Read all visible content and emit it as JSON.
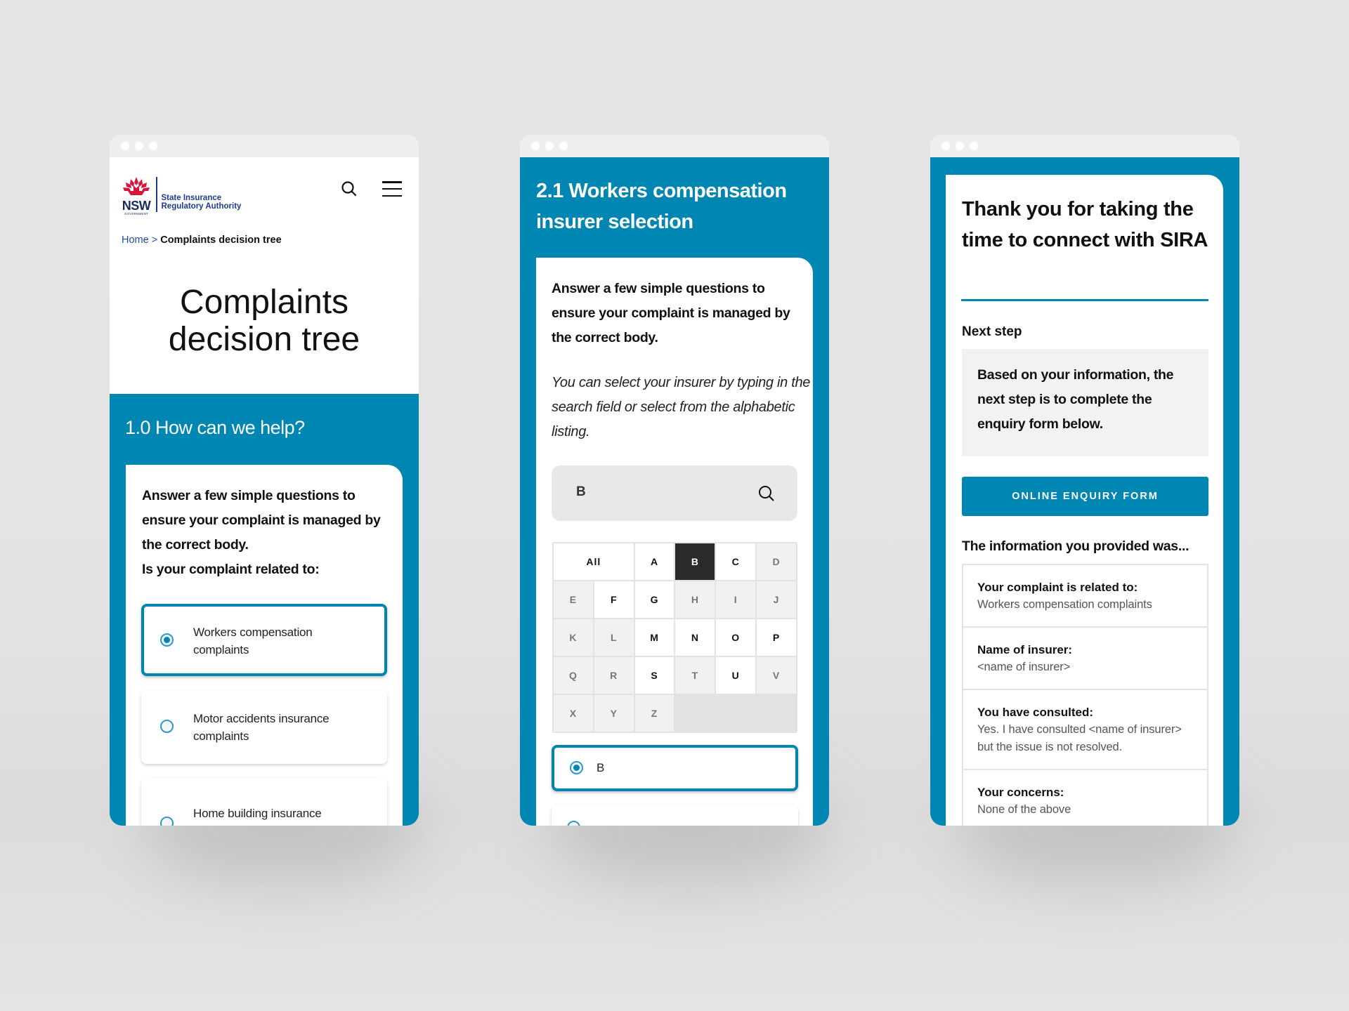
{
  "colors": {
    "accent": "#0086b3",
    "brand_red": "#d7153a",
    "brand_navy": "#1a2a5c"
  },
  "screen1": {
    "logo": {
      "mark": "NSW",
      "sub": "GOVERNMENT",
      "agency_line1": "State Insurance",
      "agency_line2": "Regulatory Authority"
    },
    "header_icons": [
      "search-icon",
      "menu-icon"
    ],
    "breadcrumb": {
      "home": "Home",
      "separator": " > ",
      "current": "Complaints decision tree"
    },
    "page_title_line1": "Complaints",
    "page_title_line2": "decision tree",
    "section_title": "1.0 How can we help?",
    "intro": "Answer a few simple questions to ensure your complaint is managed by the correct body.",
    "question": "Is your complaint related to:",
    "options": [
      {
        "label": "Workers compensation complaints",
        "selected": true
      },
      {
        "label": "Motor accidents insurance complaints",
        "selected": false
      },
      {
        "label": "Home building insurance",
        "selected": false
      }
    ]
  },
  "screen2": {
    "section_title": "2.1 Workers compensation insurer selection",
    "intro": "Answer a few simple questions to ensure your complaint is managed by the correct body.",
    "help_text": "You can select your insurer by typing in the search field or select from the alphabetic listing.",
    "search": {
      "value": "B",
      "icon": "search-icon"
    },
    "alphabet": [
      {
        "label": "All",
        "state": "enabled",
        "wide": true
      },
      {
        "label": "A",
        "state": "enabled"
      },
      {
        "label": "B",
        "state": "active"
      },
      {
        "label": "C",
        "state": "enabled"
      },
      {
        "label": "D",
        "state": "disabled"
      },
      {
        "label": "E",
        "state": "disabled"
      },
      {
        "label": "F",
        "state": "enabled"
      },
      {
        "label": "G",
        "state": "enabled"
      },
      {
        "label": "H",
        "state": "disabled"
      },
      {
        "label": "I",
        "state": "disabled"
      },
      {
        "label": "J",
        "state": "disabled"
      },
      {
        "label": "K",
        "state": "disabled"
      },
      {
        "label": "L",
        "state": "disabled"
      },
      {
        "label": "M",
        "state": "enabled"
      },
      {
        "label": "N",
        "state": "enabled"
      },
      {
        "label": "O",
        "state": "enabled"
      },
      {
        "label": "P",
        "state": "enabled"
      },
      {
        "label": "Q",
        "state": "disabled"
      },
      {
        "label": "R",
        "state": "disabled"
      },
      {
        "label": "S",
        "state": "enabled"
      },
      {
        "label": "T",
        "state": "disabled"
      },
      {
        "label": "U",
        "state": "enabled"
      },
      {
        "label": "V",
        "state": "disabled"
      },
      {
        "label": "X",
        "state": "disabled"
      },
      {
        "label": "Y",
        "state": "disabled"
      },
      {
        "label": "Z",
        "state": "disabled"
      }
    ],
    "results": [
      {
        "label": "B",
        "selected": true
      },
      {
        "label": "",
        "selected": false
      }
    ]
  },
  "screen3": {
    "heading": "Thank you for taking the time to connect with SIRA",
    "next_step_label": "Next step",
    "next_step_text": "Based on your information, the next step is to complete the enquiry form below.",
    "button_label": "ONLINE ENQUIRY FORM",
    "info_heading": "The information you provided was...",
    "info": [
      {
        "key": "Your complaint is related to:",
        "value": "Workers compensation complaints"
      },
      {
        "key": "Name of insurer:",
        "value": "<name of insurer>"
      },
      {
        "key": "You have consulted:",
        "value": "Yes. I have consulted <name of insurer> but the issue is not resolved."
      },
      {
        "key": "Your concerns:",
        "value": "None of the above"
      }
    ]
  }
}
